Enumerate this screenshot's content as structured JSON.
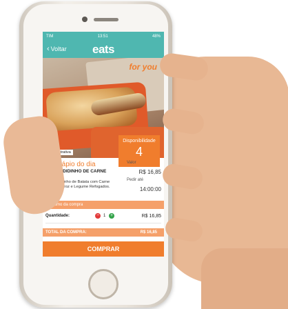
{
  "colors": {
    "brand_teal": "#4fb7b0",
    "accent_orange": "#f07d2d",
    "light_orange": "#f5a06a"
  },
  "status": {
    "carrier": "TIM",
    "time": "13:51",
    "battery": "48%"
  },
  "nav": {
    "back_label": "Voltar",
    "logo": "eats"
  },
  "photo": {
    "box_text": "for you",
    "caption": "Foto ilustrativa"
  },
  "availability": {
    "label": "Disponibilidade",
    "count": "4"
  },
  "meal": {
    "menu_title": "Cardápio do dia",
    "dish_name": "ESCONDIDINHO DE CARNE MOÍDA",
    "description": "Escondidinho de Batata com Carne Moída, Arroz e Legume Refogados.",
    "price_label": "Valor",
    "price": "R$ 16,85",
    "order_label": "Pedir até",
    "order_deadline": "14:00:00"
  },
  "summary": {
    "title": "Resumo da compra",
    "quantity_label": "Quantidade:",
    "quantity": "1",
    "line_total": "R$ 16,85",
    "total_label": "TOTAL DA COMPRA:",
    "total": "R$ 16,85"
  },
  "buy_label": "COMPRAR"
}
